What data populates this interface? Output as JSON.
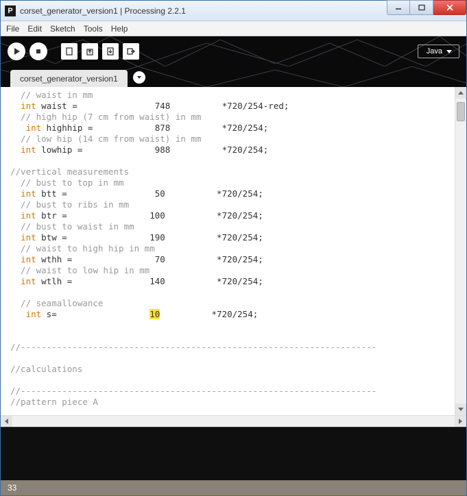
{
  "window": {
    "title": "corset_generator_version1 | Processing 2.2.1",
    "app_icon_letter": "P"
  },
  "menu": {
    "file": "File",
    "edit": "Edit",
    "sketch": "Sketch",
    "tools": "Tools",
    "help": "Help"
  },
  "toolbar": {
    "mode": "Java"
  },
  "tabs": {
    "t1": "corset_generator_version1"
  },
  "code": {
    "l1": "  // waist in mm",
    "l2a": "  ",
    "l2b": "int",
    "l2c": " waist =               748          *720/254-red;",
    "l3": "  // high hip (7 cm from waist) in mm",
    "l4a": "   ",
    "l4b": "int",
    "l4c": " highhip =            878          *720/254;",
    "l5": "  // low hip (14 cm from waist) in mm",
    "l6a": "  ",
    "l6b": "int",
    "l6c": " lowhip =              988          *720/254;",
    "l7": " ",
    "l8": "//vertical measurements",
    "l9": "  // bust to top in mm",
    "l10a": "  ",
    "l10b": "int",
    "l10c": " btt =                 50          *720/254;",
    "l11": "  // bust to ribs in mm",
    "l12a": "  ",
    "l12b": "int",
    "l12c": " btr =                100          *720/254;",
    "l13": "  // bust to waist in mm",
    "l14a": "  ",
    "l14b": "int",
    "l14c": " btw =                190          *720/254;",
    "l15": "  // waist to high hip in mm",
    "l16a": "  ",
    "l16b": "int",
    "l16c": " wthh =                70          *720/254;",
    "l17": "  // waist to low hip in mm",
    "l18a": "  ",
    "l18b": "int",
    "l18c": " wtlh =               140          *720/254;",
    "l19": " ",
    "l20": "  // seamallowance",
    "l21a": "   ",
    "l21b": "int",
    "l21c": " s=                  ",
    "l21d": "10",
    "l21e": "          *720/254;",
    "l22": " ",
    "l23": " ",
    "l24": "//---------------------------------------------------------------------",
    "l25": " ",
    "l26": "//calculations",
    "l27": " ",
    "l28": "//---------------------------------------------------------------------",
    "l29": "//pattern piece A"
  },
  "status": {
    "line": "33"
  }
}
